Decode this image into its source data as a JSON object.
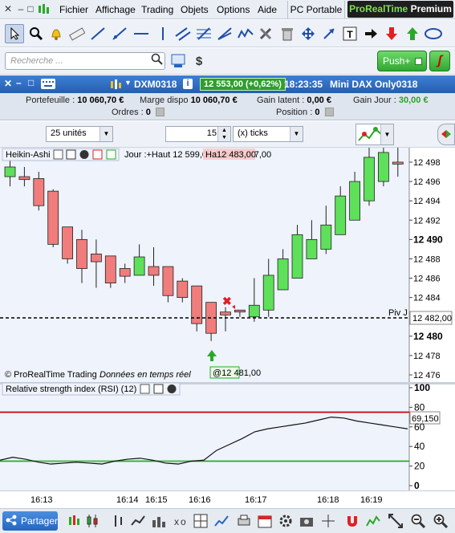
{
  "menu": {
    "items": [
      "Fichier",
      "Affichage",
      "Trading",
      "Objets",
      "Options",
      "Aide"
    ],
    "pc_portable": "PC Portable",
    "brand_green": "ProRealTime",
    "brand_white": "Premium"
  },
  "search": {
    "placeholder": "Recherche ..."
  },
  "push": {
    "label": "Push+"
  },
  "instrument": {
    "symbol": "DXM0318",
    "price_badge": "12 553,00 (+0,62%)",
    "time": "18:23:35",
    "name": "Mini DAX Only0318"
  },
  "account": {
    "portefeuille_label": "Portefeuille :",
    "portefeuille_value": "10 060,70 €",
    "marge_label": "Marge dispo",
    "marge_value": "10 060,70 €",
    "gain_latent_label": "Gain latent :",
    "gain_latent_value": "0,00 €",
    "gain_jour_label": "Gain Jour :",
    "gain_jour_value": "30,00 €",
    "ordres_label": "Ordres :",
    "ordres_value": "0",
    "position_label": "Position :",
    "position_value": "0"
  },
  "controls": {
    "quantity": "25 unités",
    "ticks_value": "15",
    "ticks_unit": "(x) ticks"
  },
  "chart": {
    "indicator_title": "Heikin-Ashi",
    "info": "Jour :+Haut 12 599,00 Bas 12 477,00",
    "info_overlay": "Ha12 483,00",
    "copyright": "© ProRealTime Trading",
    "realtime": "Données en temps réel",
    "fill_label": "@12 481,00",
    "piv_label": "Piv J",
    "piv_value": "12 482,00",
    "price_axis": [
      "12 498",
      "12 496",
      "12 494",
      "12 492",
      "12 490",
      "12 488",
      "12 486",
      "12 484",
      "12 482",
      "12 480",
      "12 478",
      "12 476"
    ],
    "rsi_title": "Relative strength index (RSI) (12)",
    "rsi_axis": [
      "100",
      "80",
      "60",
      "40",
      "20",
      "0"
    ],
    "rsi_value": "69,150",
    "time_axis": [
      "16:13",
      "16:14",
      "16:15",
      "16:16",
      "16:17",
      "16:18",
      "16:19"
    ]
  },
  "chart_data": [
    {
      "type": "candlestick",
      "title": "Heikin-Ashi",
      "ylim": [
        12475,
        12499
      ],
      "candles": [
        {
          "o": 12496.5,
          "c": 12497.5,
          "h": 12498.5,
          "l": 12495.5
        },
        {
          "o": 12496.5,
          "c": 12496.2,
          "h": 12497.5,
          "l": 12495.5
        },
        {
          "o": 12496.3,
          "c": 12493.5,
          "h": 12497.0,
          "l": 12493.0
        },
        {
          "o": 12495.0,
          "c": 12489.5,
          "h": 12495.2,
          "l": 12489.2
        },
        {
          "o": 12491.3,
          "c": 12488.0,
          "h": 12491.3,
          "l": 12487.5
        },
        {
          "o": 12490.0,
          "c": 12487.0,
          "h": 12491.0,
          "l": 12485.5
        },
        {
          "o": 12488.5,
          "c": 12487.7,
          "h": 12490.0,
          "l": 12485.0
        },
        {
          "o": 12488.3,
          "c": 12485.5,
          "h": 12488.3,
          "l": 12485.0
        },
        {
          "o": 12487.0,
          "c": 12486.2,
          "h": 12487.5,
          "l": 12485.5
        },
        {
          "o": 12486.3,
          "c": 12488.2,
          "h": 12489.5,
          "l": 12486.3
        },
        {
          "o": 12487.2,
          "c": 12486.3,
          "h": 12489.2,
          "l": 12485.2
        },
        {
          "o": 12487.2,
          "c": 12484.2,
          "h": 12487.2,
          "l": 12483.5
        },
        {
          "o": 12485.7,
          "c": 12484.0,
          "h": 12486.0,
          "l": 12483.5
        },
        {
          "o": 12485.2,
          "c": 12481.3,
          "h": 12485.2,
          "l": 12480.5
        },
        {
          "o": 12483.5,
          "c": 12480.3,
          "h": 12483.5,
          "l": 12479.5
        },
        {
          "o": 12482.5,
          "c": 12482.2,
          "h": 12483.0,
          "l": 12480.5
        },
        {
          "o": 12482.7,
          "c": 12482.5,
          "h": 12482.7,
          "l": 12482.0
        },
        {
          "o": 12482.0,
          "c": 12483.2,
          "h": 12486.0,
          "l": 12481.5
        },
        {
          "o": 12482.7,
          "c": 12486.3,
          "h": 12488.0,
          "l": 12482.0
        },
        {
          "o": 12484.8,
          "c": 12488.0,
          "h": 12489.0,
          "l": 12484.8
        },
        {
          "o": 12486.0,
          "c": 12490.5,
          "h": 12491.5,
          "l": 12486.0
        },
        {
          "o": 12488.0,
          "c": 12490.0,
          "h": 12492.0,
          "l": 12488.0
        },
        {
          "o": 12489.0,
          "c": 12491.5,
          "h": 12493.5,
          "l": 12488.5
        },
        {
          "o": 12490.5,
          "c": 12494.5,
          "h": 12495.5,
          "l": 12490.5
        },
        {
          "o": 12492.0,
          "c": 12496.0,
          "h": 12497.0,
          "l": 12492.0
        },
        {
          "o": 12494.0,
          "c": 12498.5,
          "h": 12499.5,
          "l": 12493.5
        },
        {
          "o": 12496.0,
          "c": 12499.0,
          "h": 12499.5,
          "l": 12495.5
        },
        {
          "o": 12498.0,
          "c": 12497.8,
          "h": 12499.5,
          "l": 12496.5
        }
      ],
      "colors": {
        "up": "#5ee05a",
        "down": "#f07c7c"
      }
    },
    {
      "type": "line",
      "title": "Relative strength index (RSI) (12)",
      "ylim": [
        0,
        100
      ],
      "levels": [
        {
          "y": 75,
          "color": "#cc0000"
        },
        {
          "y": 25,
          "color": "#2aa82a"
        }
      ],
      "values": [
        26,
        29,
        27,
        24,
        22,
        23,
        24,
        23,
        22,
        25,
        27,
        28,
        26,
        23,
        22,
        25,
        26,
        36,
        42,
        48,
        55,
        58,
        60,
        62,
        64,
        67,
        70,
        69,
        66,
        64,
        62,
        60,
        58
      ]
    }
  ]
}
